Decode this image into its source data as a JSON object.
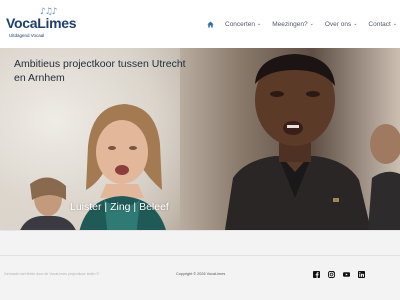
{
  "brand": {
    "title": "VocaLimes",
    "subtitle": "Uitdagend Vocaal",
    "notes": "♪♫♪"
  },
  "nav": {
    "items": [
      {
        "label": "Concerten"
      },
      {
        "label": "Meezingen?"
      },
      {
        "label": "Over ons"
      },
      {
        "label": "Contact"
      }
    ]
  },
  "hero": {
    "title": "Ambitieus projectkoor tussen Utrecht en Arnhem",
    "tagline": "Luister | Zing | Beleef"
  },
  "footer": {
    "left_text": "Gemaakt met liefde door de VocaLimes projectkoor leden ©",
    "copyright": "Copyright © 2026 VocaLimes",
    "socials": [
      "facebook-icon",
      "instagram-icon",
      "youtube-icon",
      "linkedin-icon"
    ]
  },
  "colors": {
    "brand_blue": "#1f3f72",
    "accent_blue": "#2b6cb0",
    "footer_bg": "#f3f3f3"
  }
}
